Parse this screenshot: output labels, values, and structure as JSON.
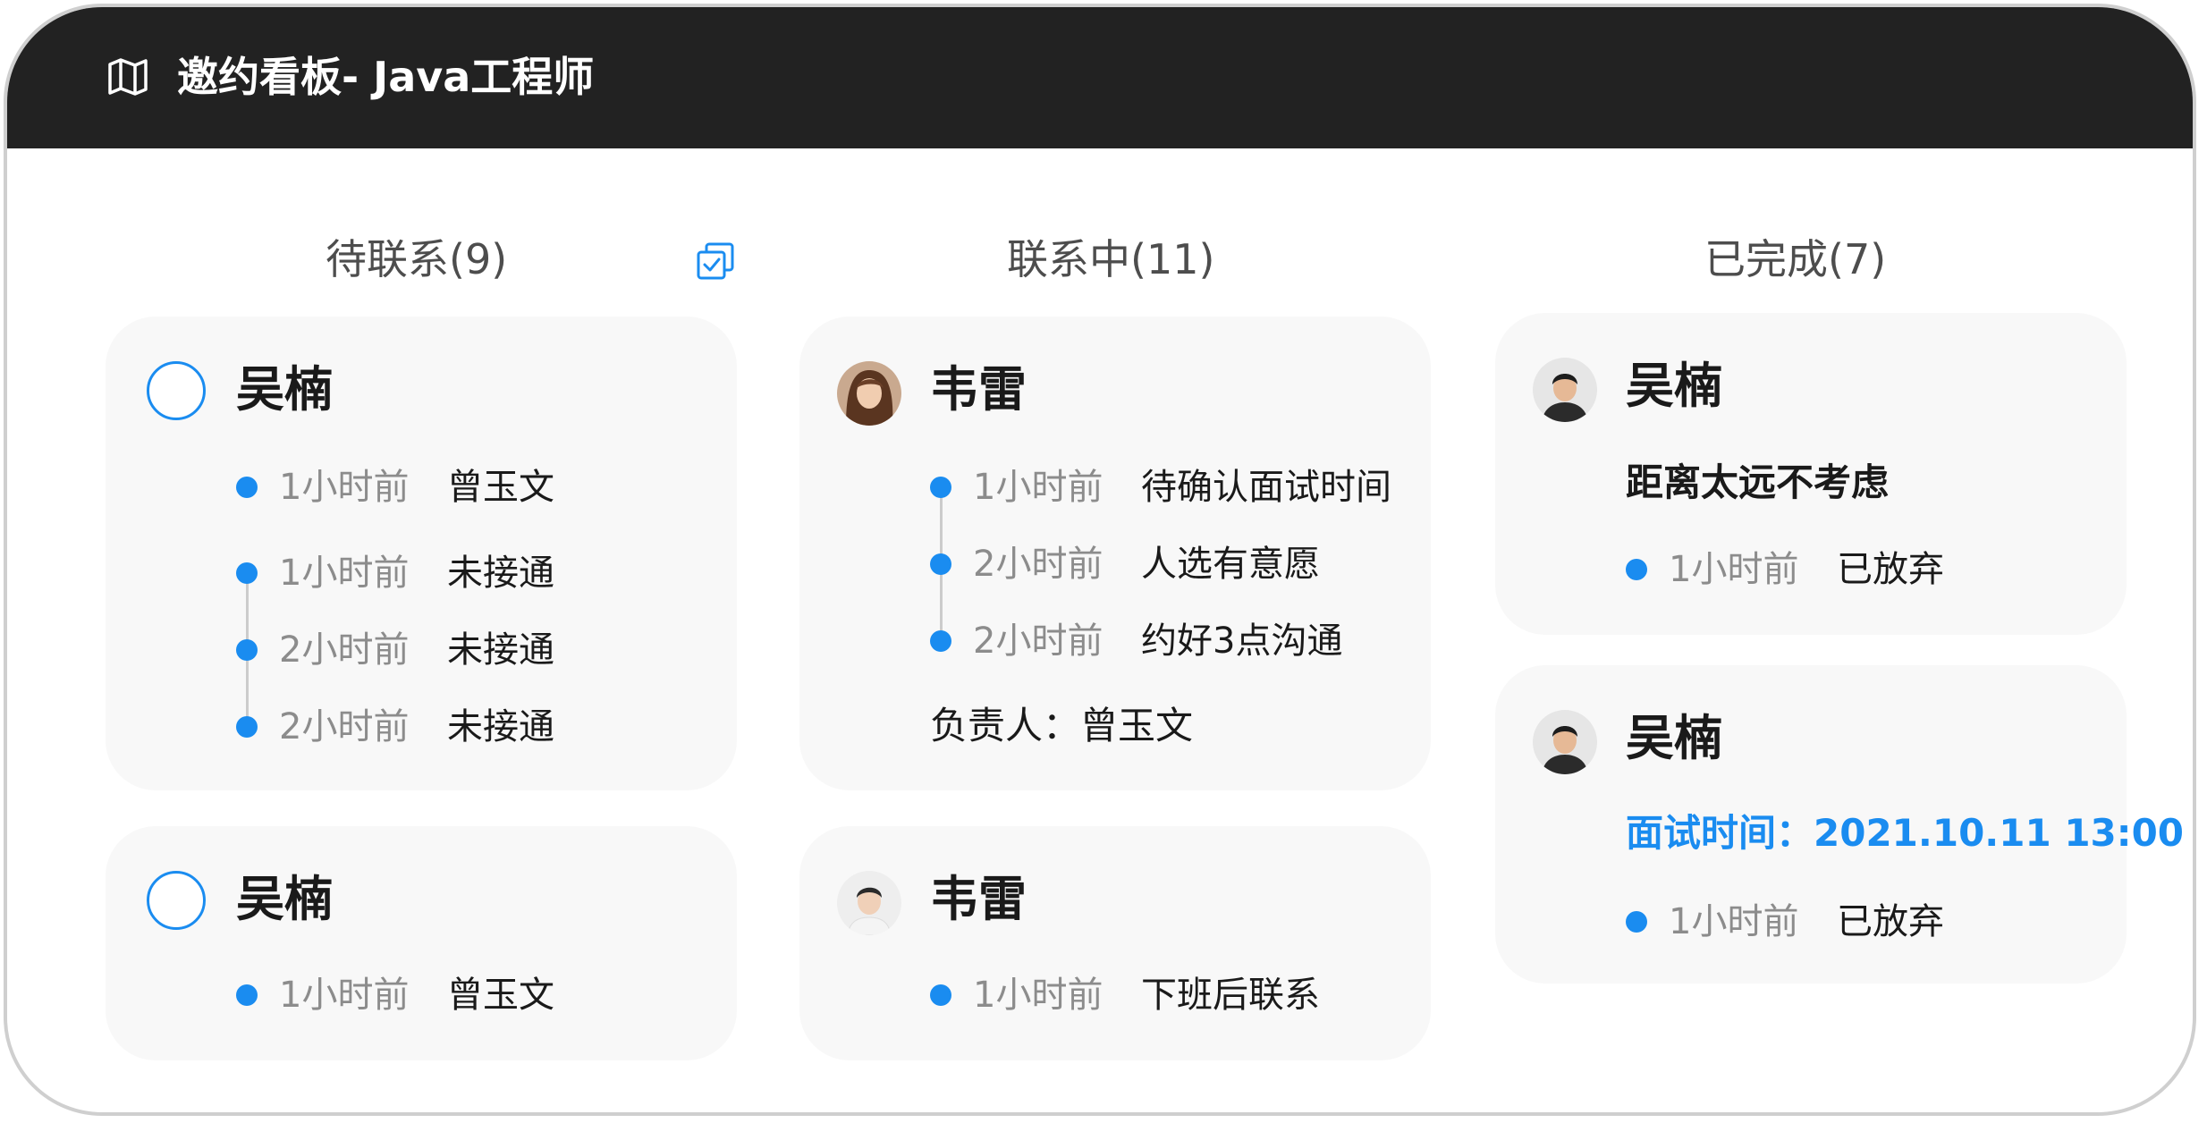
{
  "header": {
    "title": "邀约看板- Java工程师",
    "icon": "map-icon"
  },
  "colors": {
    "accent": "#1a8cf0",
    "header_bg": "#222222",
    "card_bg": "#f8f8f8"
  },
  "columns": [
    {
      "title": "待联系(9)",
      "cards": [
        {
          "name": "吴楠",
          "entries": [
            {
              "time": "1小时前",
              "action": "曾玉文"
            },
            {
              "time": "1小时前",
              "action": "未接通"
            },
            {
              "time": "2小时前",
              "action": "未接通"
            },
            {
              "time": "2小时前",
              "action": "未接通"
            }
          ]
        },
        {
          "name": "吴楠",
          "entries": [
            {
              "time": "1小时前",
              "action": "曾玉文"
            }
          ]
        }
      ]
    },
    {
      "title": "联系中(11)",
      "cards": [
        {
          "name": "韦雷",
          "entries": [
            {
              "time": "1小时前",
              "action": "待确认面试时间"
            },
            {
              "time": "2小时前",
              "action": "人选有意愿"
            },
            {
              "time": "2小时前",
              "action": "约好3点沟通"
            }
          ],
          "owner": "负责人：曾玉文"
        },
        {
          "name": "韦雷",
          "entries": [
            {
              "time": "1小时前",
              "action": "下班后联系"
            }
          ]
        }
      ]
    },
    {
      "title": "已完成(7)",
      "cards": [
        {
          "name": "吴楠",
          "note": "距离太远不考虑",
          "entries": [
            {
              "time": "1小时前",
              "action": "已放弃"
            }
          ]
        },
        {
          "name": "吴楠",
          "interview": "面试时间：2021.10.11 13:00",
          "entries": [
            {
              "time": "1小时前",
              "action": "已放弃"
            }
          ]
        }
      ]
    }
  ]
}
